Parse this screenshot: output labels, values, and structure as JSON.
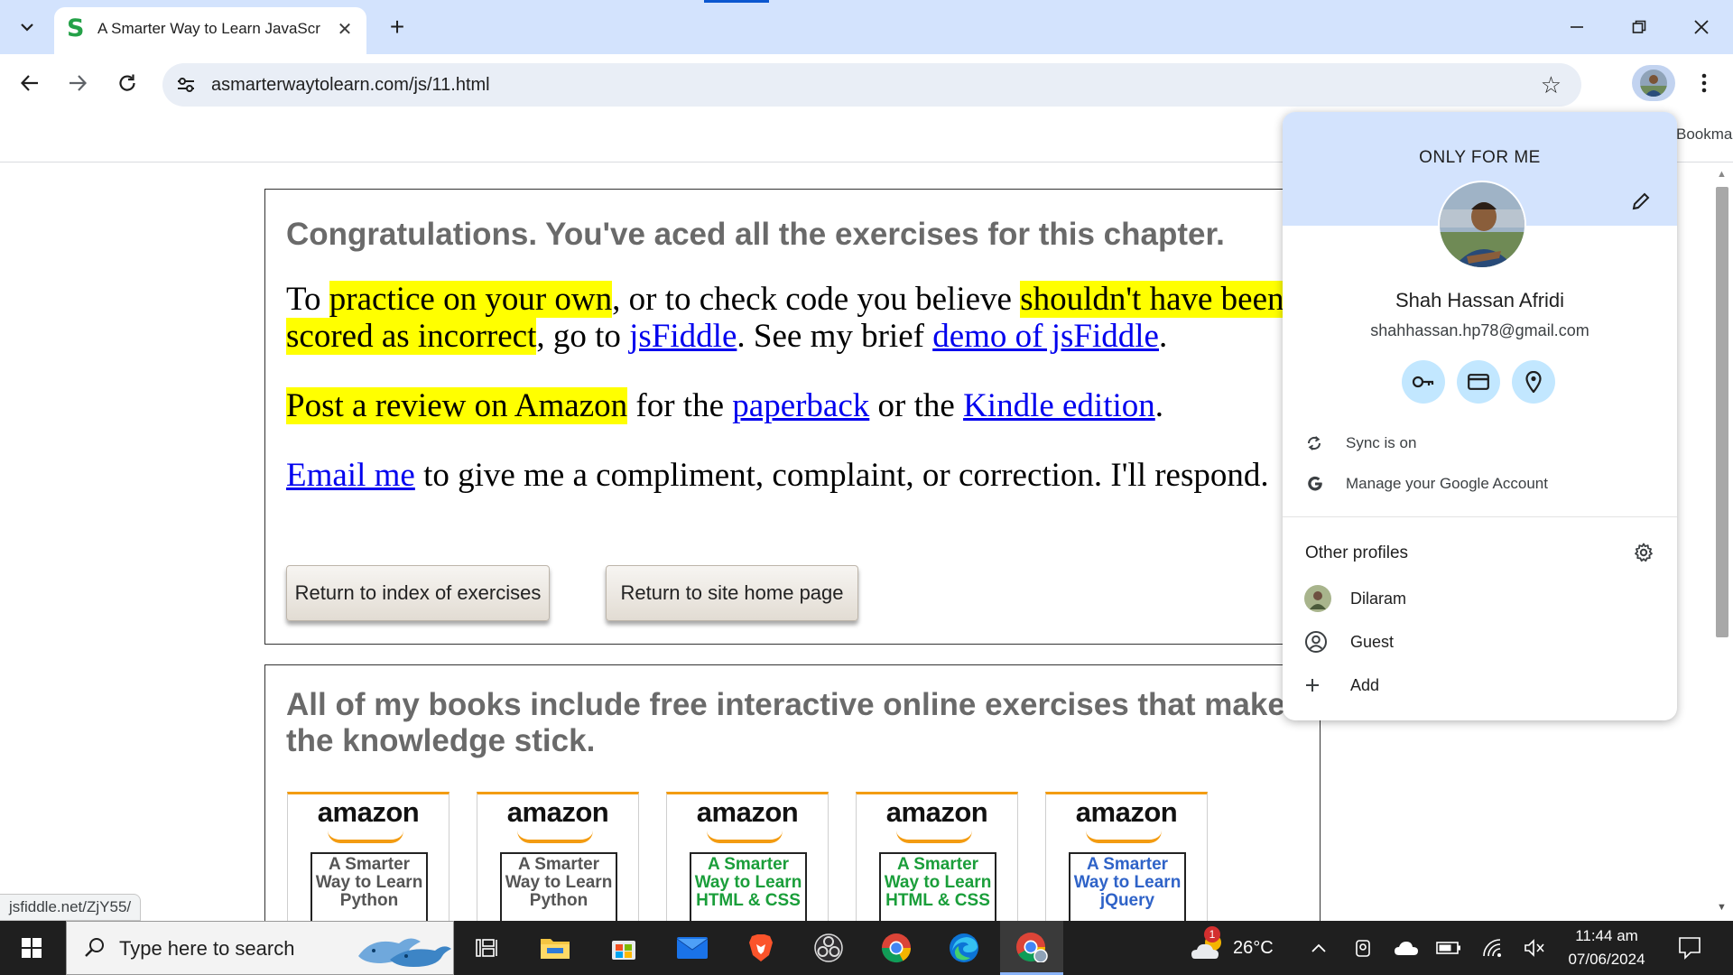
{
  "browser": {
    "tab": {
      "favicon": "S",
      "title": "A Smarter Way to Learn JavaScri",
      "close": "✕"
    },
    "new_tab": "+",
    "url": "asmarterwaytolearn.com/js/11.html",
    "bookmarks_label": "Bookmarks"
  },
  "page": {
    "congrats": "Congratulations. You've aced all the exercises for this chapter.",
    "para1": {
      "t1": "To ",
      "hl1": "practice on your own",
      "t2": ", or to check code you believe ",
      "hl2": "shouldn't have been scored as incorrect",
      "t3": ", go to ",
      "link1": "jsFiddle",
      "t4": ". See my brief ",
      "link2": "demo of jsFiddle",
      "t5": "."
    },
    "para2": {
      "hl": "Post a review on Amazon",
      "t1": " for the ",
      "link1": "paperback",
      "t2": " or the ",
      "link2": "Kindle edition",
      "t3": "."
    },
    "para3": {
      "link": "Email me",
      "t1": " to give me a compliment, complaint, or correction. I'll respond."
    },
    "buttons": {
      "index": "Return to index of exercises",
      "home": "Return to site home page"
    },
    "books_heading": " All of my books include free interactive online exercises that make the knowledge stick.",
    "books": [
      {
        "brand": "amazon",
        "cover": "A Smarter Way to Learn Python",
        "color": "#555555"
      },
      {
        "brand": "amazon",
        "cover": "A Smarter Way to Learn Python",
        "color": "#555555"
      },
      {
        "brand": "amazon",
        "cover": "A Smarter Way to Learn HTML & CSS",
        "color": "#1a9e3a"
      },
      {
        "brand": "amazon",
        "cover": "A Smarter Way to Learn HTML & CSS",
        "color": "#1a9e3a"
      },
      {
        "brand": "amazon",
        "cover": "A Smarter Way to Learn jQuery",
        "color": "#2f63c8"
      }
    ],
    "status_url": "jsfiddle.net/ZjY55/"
  },
  "profile_popup": {
    "label": "ONLY FOR ME",
    "name": "Shah Hassan Afridi",
    "email": "shahhassan.hp78@gmail.com",
    "sync": "Sync is on",
    "manage": "Manage your Google Account",
    "other_profiles": "Other profiles",
    "profiles": [
      {
        "name": "Dilaram"
      },
      {
        "name": "Guest"
      },
      {
        "name": "Add"
      }
    ]
  },
  "taskbar": {
    "search_placeholder": "Type here to search",
    "weather_badge": "1",
    "temperature": "26°C",
    "time": "11:44 am",
    "date": "07/06/2024"
  }
}
